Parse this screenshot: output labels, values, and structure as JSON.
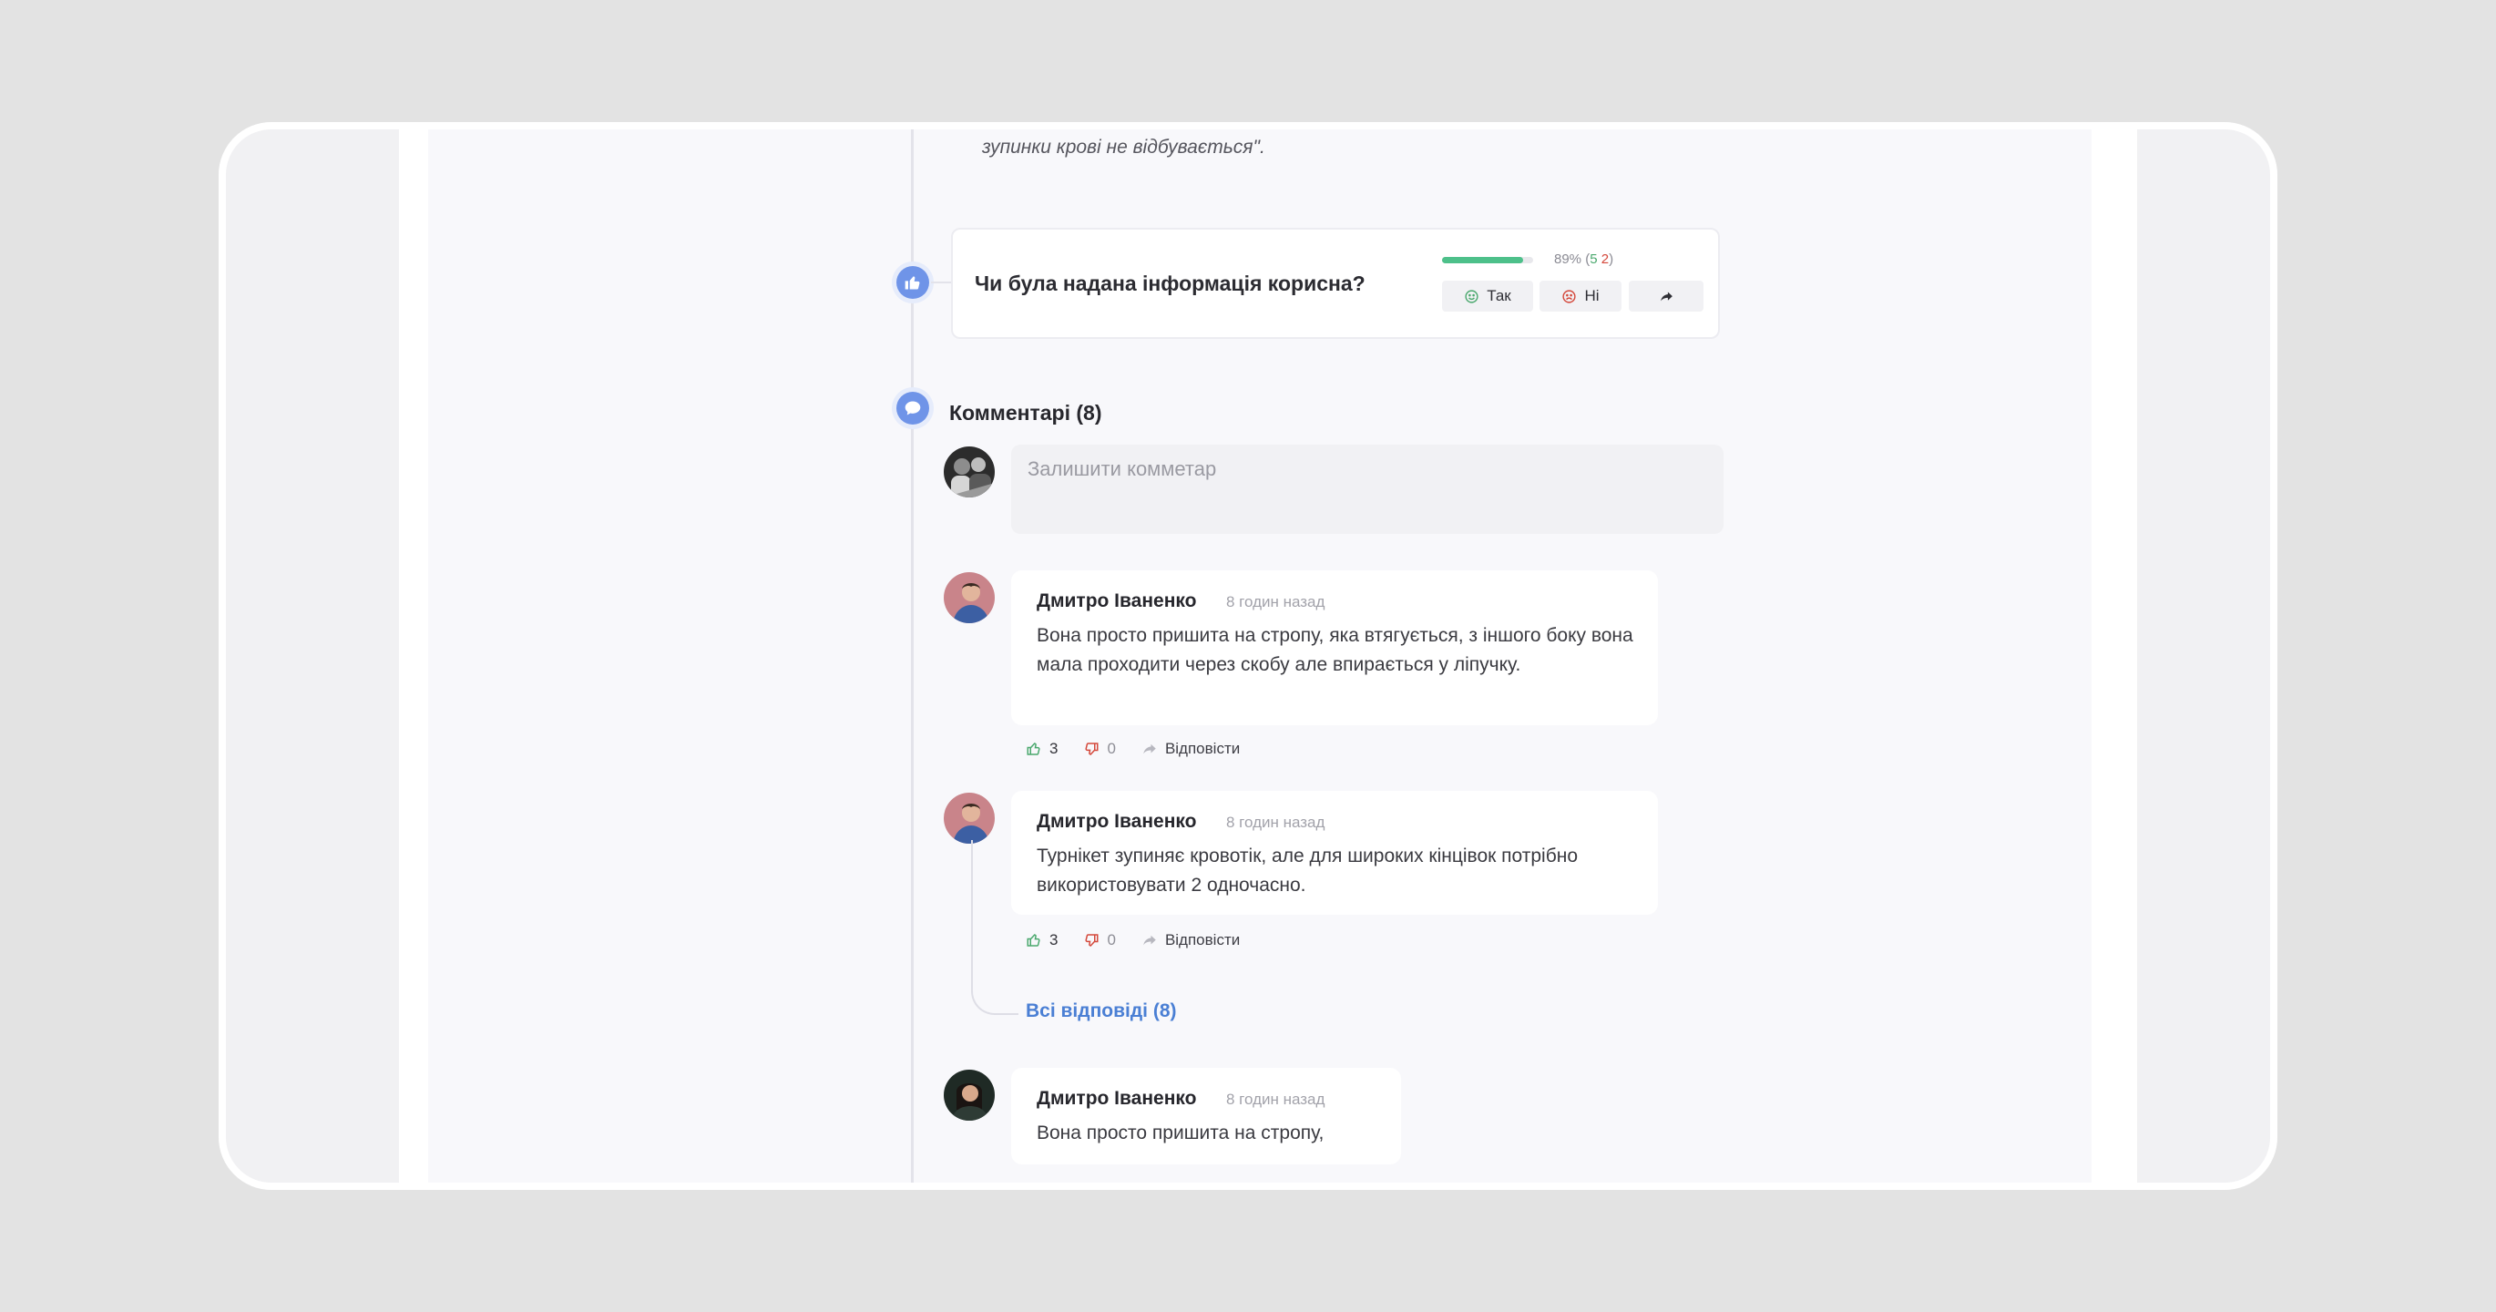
{
  "quote": {
    "faded_text": "…………………………………………………………………………………",
    "text": "зупинки крові не відбувається\"."
  },
  "feedback": {
    "question": "Чи була надана інформація корисна?",
    "percent": 89,
    "percent_label": "89%",
    "yes_count": "5",
    "no_count": "2",
    "yes_label": "Так",
    "no_label": "Ні"
  },
  "comments_section": {
    "title": "Комментарі (8)",
    "input_placeholder": "Залишити комметар",
    "all_replies_label": "Всі відповіді (8)",
    "reply_label": "Відповісти",
    "items": [
      {
        "author": "Дмитро Іваненко",
        "time": "8 годин назад",
        "text": "Вона просто пришита на стропу, яка втягується, з іншого боку вона мала проходити через скобу але впирається у ліпучку.",
        "likes": "3",
        "dislikes": "0"
      },
      {
        "author": "Дмитро Іваненко",
        "time": "8 годин назад",
        "text": "Турнікет зупиняє кровотік, але для широких кінцівок потрібно використовувати 2 одночасно.",
        "likes": "3",
        "dislikes": "0"
      },
      {
        "author": "Дмитро Іваненко",
        "time": "8 годин назад",
        "text": "Вона просто пришита на стропу,"
      }
    ]
  },
  "icons": {
    "feedback_node": "thumbs-up-icon",
    "comments_node": "chat-bubble-icon",
    "yes_icon": "smile-icon",
    "no_icon": "frown-icon",
    "share_icon": "share-arrow-icon",
    "like_icon": "thumbs-up-outline-icon",
    "dislike_icon": "thumbs-down-outline-icon",
    "reply_icon": "reply-arrow-icon"
  },
  "colors": {
    "accent": "#6f94e8",
    "link": "#4a7fd4",
    "positive": "#4dc08a",
    "negative": "#d4483b"
  }
}
